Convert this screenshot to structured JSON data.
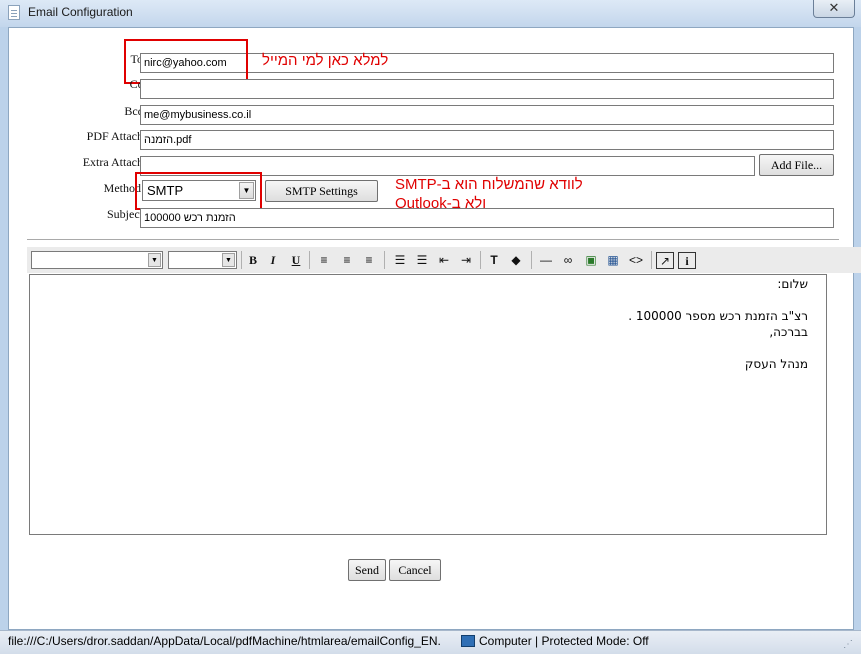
{
  "window": {
    "title": "Email Configuration",
    "close_glyph": "✕"
  },
  "form": {
    "to": {
      "label": "To",
      "value": "nirc@yahoo.com"
    },
    "cc": {
      "label": "Cc",
      "value": ""
    },
    "bcc": {
      "label": "Bcc",
      "value": "me@mybusiness.co.il"
    },
    "pdf_attach": {
      "label": "PDF Attach",
      "value": "הזמנה.pdf"
    },
    "extra_attach": {
      "label": "Extra Attach",
      "value": "",
      "button": "Add File..."
    },
    "method": {
      "label": "Method",
      "value": "SMTP",
      "button": "SMTP Settings"
    },
    "subject": {
      "label": "Subject",
      "value": "הזמנת רכש 100000"
    }
  },
  "annotations": {
    "to_note": "למלא כאן למי המייל",
    "method_note_line1": "לוודא שהמשלוח הוא ב-SMTP",
    "method_note_line2": "ולא ב-Outlook"
  },
  "toolbar": {
    "bold": "B",
    "italic": "I",
    "underline": "U",
    "icons": [
      "align-left-icon",
      "align-center-icon",
      "align-right-icon",
      "ordered-list-icon",
      "unordered-list-icon",
      "outdent-icon",
      "indent-icon",
      "text-color-icon",
      "background-color-icon",
      "horizontal-rule-icon",
      "link-icon",
      "image-icon",
      "table-icon",
      "html-source-icon",
      "popup-editor-icon",
      "about-icon"
    ]
  },
  "editor": {
    "lines": [
      "שלום:",
      "",
      "רצ\"ב הזמנת רכש מספר 100000 .",
      "בברכה,",
      "",
      "מנהל העסק"
    ]
  },
  "actions": {
    "send": "Send",
    "cancel": "Cancel"
  },
  "statusbar": {
    "url": "file:///C:/Users/dror.saddan/AppData/Local/pdfMachine/htmlarea/emailConfig_EN.",
    "zone": "Computer | Protected Mode: Off"
  },
  "colors": {
    "annotation": "#e00000",
    "window_frame": "#bcd2ea"
  }
}
